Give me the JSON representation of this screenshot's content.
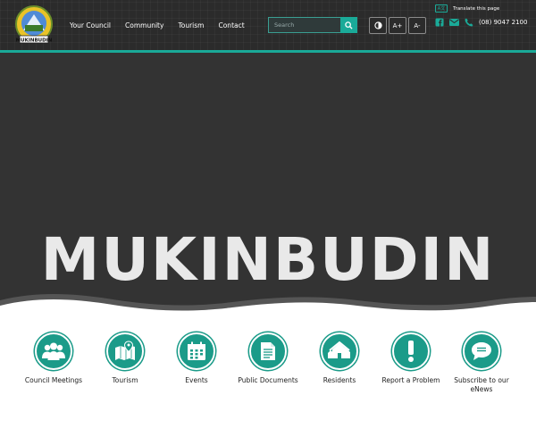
{
  "header": {
    "logo_text": "MUKINBUDIN",
    "nav": [
      {
        "label": "Your Council"
      },
      {
        "label": "Community"
      },
      {
        "label": "Tourism"
      },
      {
        "label": "Contact"
      }
    ],
    "search": {
      "placeholder": "Search"
    },
    "accessibility": {
      "increase": "A+",
      "decrease": "A-"
    },
    "translate_label": "Translate this page",
    "phone": "(08) 9047 2100",
    "accent_color": "#1aaa98"
  },
  "hero": {
    "title": "MUKINBUDIN"
  },
  "quick_links": [
    {
      "label": "Council Meetings",
      "icon": "people-icon"
    },
    {
      "label": "Tourism",
      "icon": "map-pin-icon"
    },
    {
      "label": "Events",
      "icon": "calendar-icon"
    },
    {
      "label": "Public Documents",
      "icon": "document-icon"
    },
    {
      "label": "Residents",
      "icon": "houses-icon"
    },
    {
      "label": "Report a Problem",
      "icon": "exclamation-icon"
    },
    {
      "label": "Subscribe to our eNews",
      "icon": "chat-bubble-icon"
    }
  ]
}
